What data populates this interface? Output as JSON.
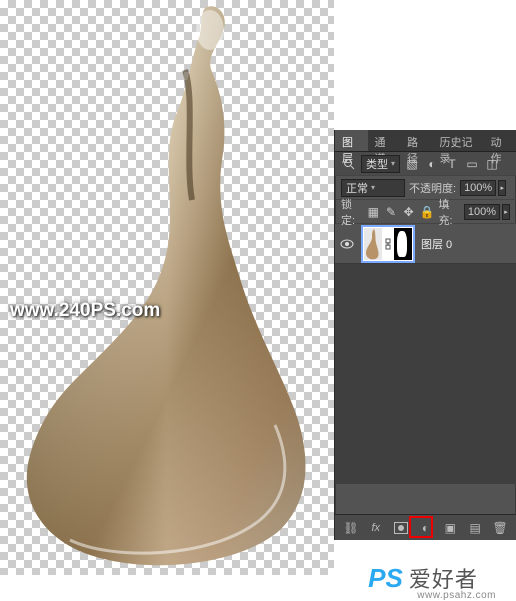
{
  "watermark": "www.240PS.com",
  "tabs": [
    "图层",
    "通道",
    "路径",
    "历史记录",
    "动作"
  ],
  "active_tab": 0,
  "filter_label": "类型",
  "blend_mode": "正常",
  "opacity_label": "不透明度:",
  "opacity_value": "100%",
  "lock_label": "锁定:",
  "fill_label": "填充:",
  "fill_value": "100%",
  "layer0_name": "图层 0",
  "footer_ps": "PS",
  "footer_cn": "爱好者",
  "footer_url": "www.psahz.com",
  "icons": {
    "search": "search-icon",
    "eye": "eye-icon",
    "link": "link-icon",
    "fx": "fx-icon",
    "mask": "mask-icon",
    "adjust": "adjust-icon",
    "group": "group-icon",
    "new": "new-icon",
    "trash": "trash-icon"
  }
}
